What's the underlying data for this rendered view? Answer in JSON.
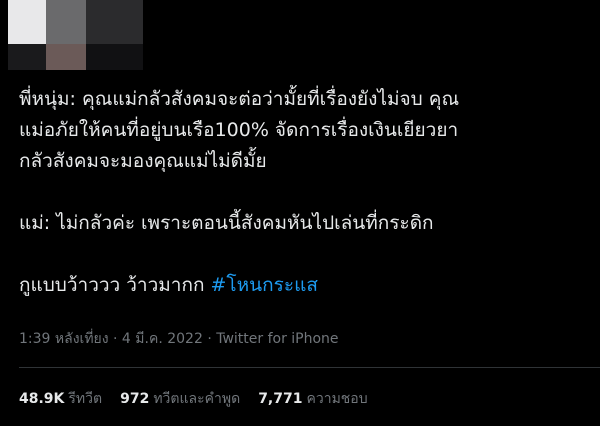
{
  "tweet": {
    "lines": [
      "พี่หนุ่ม: คุณแม่กลัวสังคมจะต่อว่ามั้ยที่เรื่องยังไม่จบ คุณ",
      "แม่อภัยให้คนที่อยู่บนเรือ100%  จัดการเรื่องเงินเยียวยา",
      "กลัวสังคมจะมองคุณแม่ไม่ดีมั้ย",
      "แม่: ไม่กลัวค่ะ เพราะตอนนี้สังคมหันไปเล่นที่กระดิก",
      "กูแบบว้าววว ว้าวมากก"
    ],
    "hashtag": "#โหนกระแส"
  },
  "meta": {
    "timestamp": "1:39 หลังเที่ยง · 4 มี.ค. 2022 · Twitter for iPhone"
  },
  "stats": {
    "retweets_count": "48.9K",
    "retweets_label": "รีทวีต",
    "quotes_count": "972",
    "quotes_label": "ทวีตและคำพูด",
    "likes_count": "7,771",
    "likes_label": "ความชอบ"
  },
  "colors": {
    "background": "#000000",
    "text": "#e7e9ea",
    "secondary": "#71767b",
    "hashtag": "#1d9bf0"
  }
}
